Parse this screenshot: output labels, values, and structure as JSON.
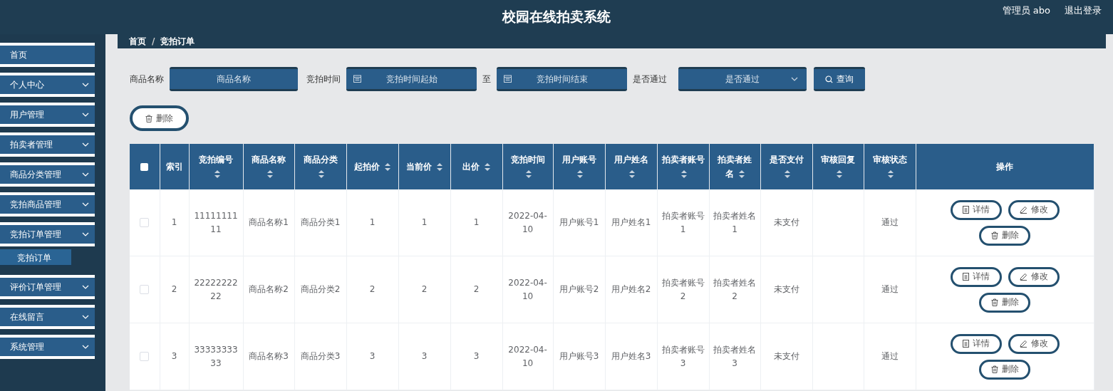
{
  "header": {
    "title": "校园在线拍卖系统",
    "user": "管理员 abo",
    "logout": "退出登录"
  },
  "sidebar": {
    "items": [
      {
        "label": "首页",
        "expandable": false
      },
      {
        "label": "个人中心",
        "expandable": true
      },
      {
        "label": "用户管理",
        "expandable": true
      },
      {
        "label": "拍卖者管理",
        "expandable": true
      },
      {
        "label": "商品分类管理",
        "expandable": true
      },
      {
        "label": "竞拍商品管理",
        "expandable": true
      },
      {
        "label": "竞拍订单管理",
        "expandable": true,
        "children": [
          {
            "label": "竞拍订单",
            "selected": true
          }
        ]
      },
      {
        "label": "评价订单管理",
        "expandable": true
      },
      {
        "label": "在线留言",
        "expandable": true
      },
      {
        "label": "系统管理",
        "expandable": true
      }
    ]
  },
  "breadcrumb": [
    "首页",
    "竞拍订单"
  ],
  "breadcrumb_separator": "/",
  "filters": [
    {
      "label": "商品名称",
      "kind": "text",
      "placeholder": "商品名称"
    },
    {
      "label": "竞拍时间",
      "kind": "date",
      "placeholder": "竞拍时间起始"
    },
    {
      "label": "至",
      "kind": "date",
      "placeholder": "竞拍时间结束"
    },
    {
      "label": "是否通过",
      "kind": "select",
      "placeholder": "是否通过"
    }
  ],
  "search_button": "查询",
  "delete_button": "删除",
  "table": {
    "select_all": {
      "checked": false
    },
    "columns": [
      {
        "label": "索引",
        "sortable": false
      },
      {
        "label": "竞拍编号",
        "sortable": true
      },
      {
        "label": "商品名称",
        "sortable": true
      },
      {
        "label": "商品分类",
        "sortable": true
      },
      {
        "label": "起拍价",
        "sortable": true
      },
      {
        "label": "当前价",
        "sortable": true
      },
      {
        "label": "出价",
        "sortable": true
      },
      {
        "label": "竞拍时间",
        "sortable": true
      },
      {
        "label": "用户账号",
        "sortable": true
      },
      {
        "label": "用户姓名",
        "sortable": true
      },
      {
        "label": "拍卖者账号",
        "sortable": true
      },
      {
        "label": "拍卖者姓名",
        "sortable": true
      },
      {
        "label": "是否支付",
        "sortable": true
      },
      {
        "label": "审核回复",
        "sortable": true
      },
      {
        "label": "审核状态",
        "sortable": true
      },
      {
        "label": "操作",
        "sortable": false
      }
    ],
    "rows": [
      {
        "checked": false,
        "cells": [
          "1",
          "1111111111",
          "商品名称1",
          "商品分类1",
          "1",
          "1",
          "1",
          "2022-04-10",
          "用户账号1",
          "用户姓名1",
          "拍卖者账号1",
          "拍卖者姓名1",
          "未支付",
          null,
          "通过"
        ],
        "actions": [
          {
            "kind": "detail",
            "label": "详情"
          },
          {
            "kind": "edit",
            "label": "修改"
          },
          {
            "kind": "delete",
            "label": "删除"
          }
        ]
      },
      {
        "checked": false,
        "cells": [
          "2",
          "2222222222",
          "商品名称2",
          "商品分类2",
          "2",
          "2",
          "2",
          "2022-04-10",
          "用户账号2",
          "用户姓名2",
          "拍卖者账号2",
          "拍卖者姓名2",
          "未支付",
          null,
          "通过"
        ],
        "actions": [
          {
            "kind": "detail",
            "label": "详情"
          },
          {
            "kind": "edit",
            "label": "修改"
          },
          {
            "kind": "delete",
            "label": "删除"
          }
        ]
      },
      {
        "checked": false,
        "cells": [
          "3",
          "3333333333",
          "商品名称3",
          "商品分类3",
          "3",
          "3",
          "3",
          "2022-04-10",
          "用户账号3",
          "用户姓名3",
          "拍卖者账号3",
          "拍卖者姓名3",
          "未支付",
          null,
          "通过"
        ],
        "actions": [
          {
            "kind": "detail",
            "label": "详情"
          },
          {
            "kind": "edit",
            "label": "修改"
          },
          {
            "kind": "delete",
            "label": "删除"
          }
        ]
      }
    ]
  }
}
